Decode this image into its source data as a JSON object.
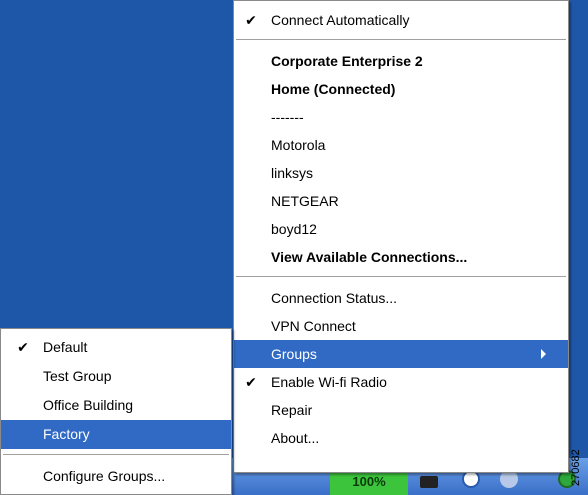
{
  "main_menu": {
    "connect_automatically": {
      "label": "Connect Automatically",
      "checked": true
    },
    "networks": [
      {
        "label": "Corporate Enterprise 2",
        "bold": true
      },
      {
        "label": "Home (Connected)",
        "bold": true
      },
      {
        "label": "-------",
        "bold": false
      },
      {
        "label": "Motorola",
        "bold": false
      },
      {
        "label": "linksys",
        "bold": false
      },
      {
        "label": "NETGEAR",
        "bold": false
      },
      {
        "label": "boyd12",
        "bold": false
      },
      {
        "label": "View Available Connections...",
        "bold": true
      }
    ],
    "connection_status": "Connection Status...",
    "vpn_connect": "VPN Connect",
    "groups": "Groups",
    "enable_wifi_radio": {
      "label": "Enable Wi-fi Radio",
      "checked": true
    },
    "repair": "Repair",
    "about": "About..."
  },
  "groups_submenu": {
    "items": [
      {
        "label": "Default",
        "checked": true
      },
      {
        "label": "Test Group",
        "checked": false
      },
      {
        "label": "Office Building",
        "checked": false
      },
      {
        "label": "Factory",
        "checked": false,
        "selected": true
      }
    ],
    "configure": "Configure Groups..."
  },
  "taskbar": {
    "battery_text": "100%"
  },
  "figure_id": "270682",
  "colors": {
    "desktop": "#1f57a8",
    "highlight": "#316ac5"
  },
  "icons": {
    "check": "check-icon",
    "submenu_arrow": "chevron-right-icon"
  }
}
